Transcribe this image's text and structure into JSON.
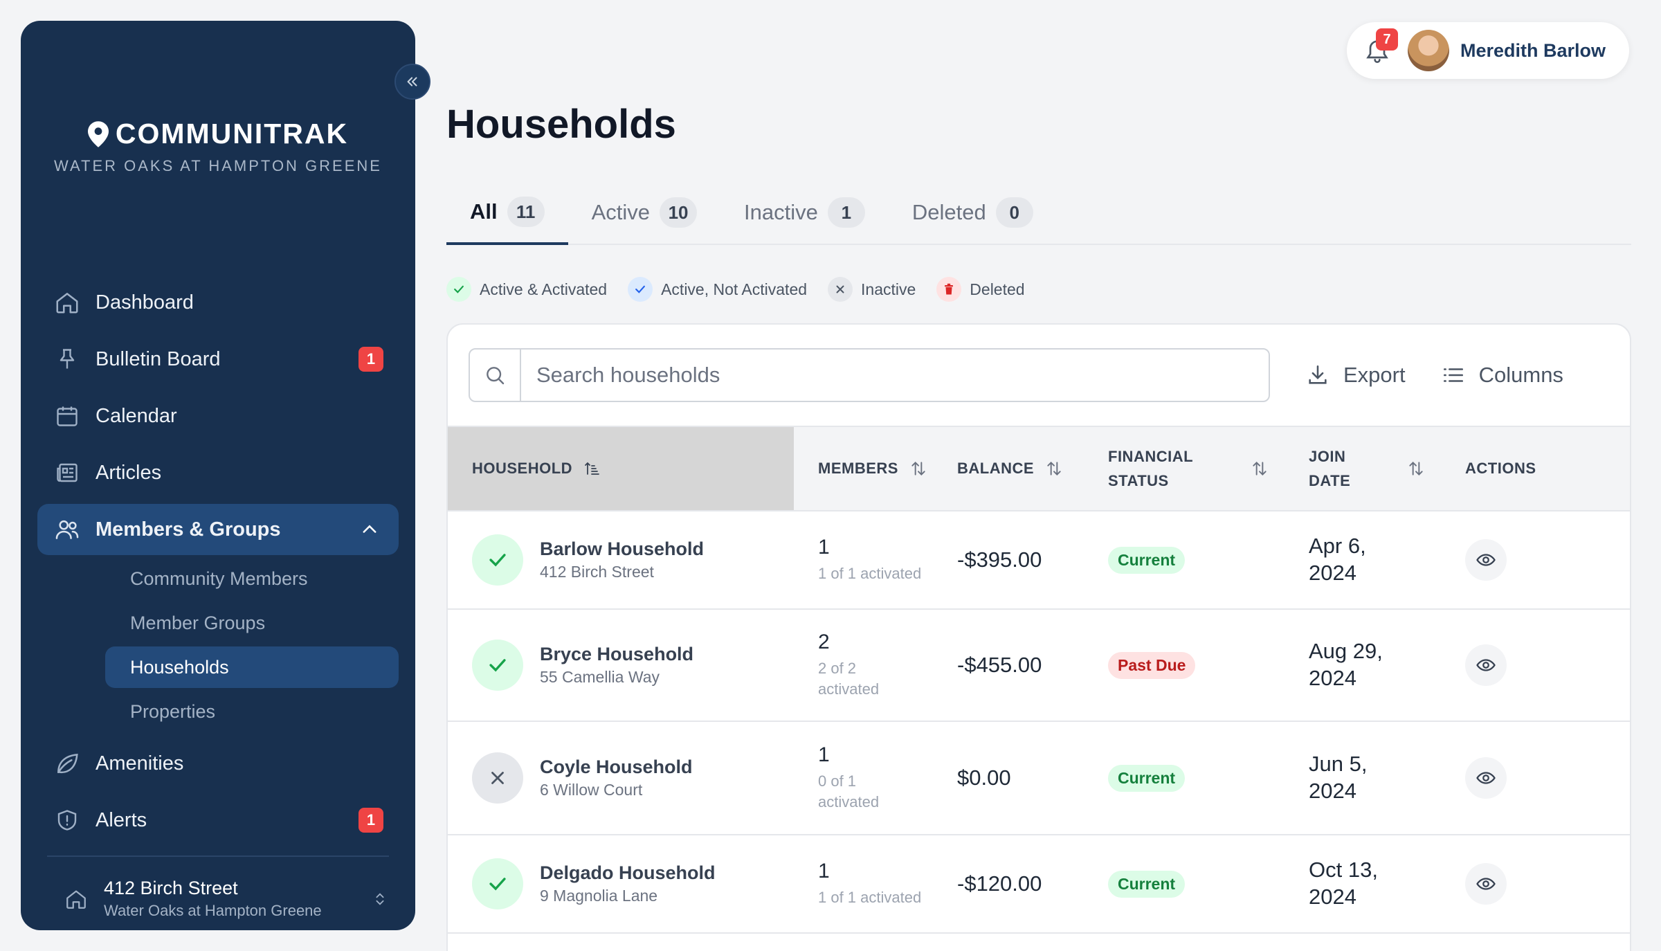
{
  "brand": {
    "name": "COMMUNITRAK",
    "community": "WATER OAKS AT HAMPTON GREENE"
  },
  "nav": [
    {
      "label": "Dashboard",
      "icon": "home-icon"
    },
    {
      "label": "Bulletin Board",
      "icon": "pin-icon",
      "badge": "1"
    },
    {
      "label": "Calendar",
      "icon": "calendar-icon"
    },
    {
      "label": "Articles",
      "icon": "newspaper-icon"
    },
    {
      "label": "Members & Groups",
      "icon": "users-icon",
      "expanded": true
    },
    {
      "label": "Amenities",
      "icon": "leaf-icon"
    },
    {
      "label": "Alerts",
      "icon": "shield-alert-icon",
      "badge": "1"
    }
  ],
  "subnav": [
    "Community Members",
    "Member Groups",
    "Households",
    "Properties"
  ],
  "subnav_active": "Households",
  "property": {
    "address": "412 Birch Street",
    "community": "Water Oaks at Hampton Greene"
  },
  "user": {
    "name": "Meredith Barlow",
    "notifications": "7"
  },
  "page": {
    "title": "Households"
  },
  "tabs": [
    {
      "label": "All",
      "count": "11"
    },
    {
      "label": "Active",
      "count": "10"
    },
    {
      "label": "Inactive",
      "count": "1"
    },
    {
      "label": "Deleted",
      "count": "0"
    }
  ],
  "legend": [
    {
      "label": "Active & Activated",
      "icon": "check-icon"
    },
    {
      "label": "Active, Not Activated",
      "icon": "check-icon"
    },
    {
      "label": "Inactive",
      "icon": "x-icon"
    },
    {
      "label": "Deleted",
      "icon": "trash-icon"
    }
  ],
  "toolbar": {
    "search_placeholder": "Search households",
    "export_label": "Export",
    "columns_label": "Columns"
  },
  "table": {
    "headers": {
      "household": "HOUSEHOLD",
      "members": "MEMBERS",
      "balance": "BALANCE",
      "financial_1": "FINANCIAL",
      "financial_2": "STATUS",
      "join_1": "JOIN",
      "join_2": "DATE",
      "actions": "ACTIONS"
    },
    "rows": [
      {
        "name": "Barlow Household",
        "address": "412 Birch Street",
        "members": "1",
        "activated_1": "1 of 1 activated",
        "activated_2": "",
        "balance": "-$395.00",
        "status": "Current",
        "join_1": "Apr 6,",
        "join_2": "2024",
        "state": "active"
      },
      {
        "name": "Bryce Household",
        "address": "55 Camellia Way",
        "members": "2",
        "activated_1": "2 of 2",
        "activated_2": "activated",
        "balance": "-$455.00",
        "status": "Past Due",
        "join_1": "Aug 29,",
        "join_2": "2024",
        "state": "active"
      },
      {
        "name": "Coyle Household",
        "address": "6 Willow Court",
        "members": "1",
        "activated_1": "0 of 1",
        "activated_2": "activated",
        "balance": "$0.00",
        "status": "Current",
        "join_1": "Jun 5,",
        "join_2": "2024",
        "state": "inactive"
      },
      {
        "name": "Delgado Household",
        "address": "9 Magnolia Lane",
        "members": "1",
        "activated_1": "1 of 1 activated",
        "activated_2": "",
        "balance": "-$120.00",
        "status": "Current",
        "join_1": "Oct 13,",
        "join_2": "2024",
        "state": "active"
      }
    ]
  },
  "colors": {
    "sidebar": "#18304f",
    "accent": "#234a7a",
    "badge": "#ef4444",
    "success": "#16a34a",
    "danger": "#dc2626"
  }
}
